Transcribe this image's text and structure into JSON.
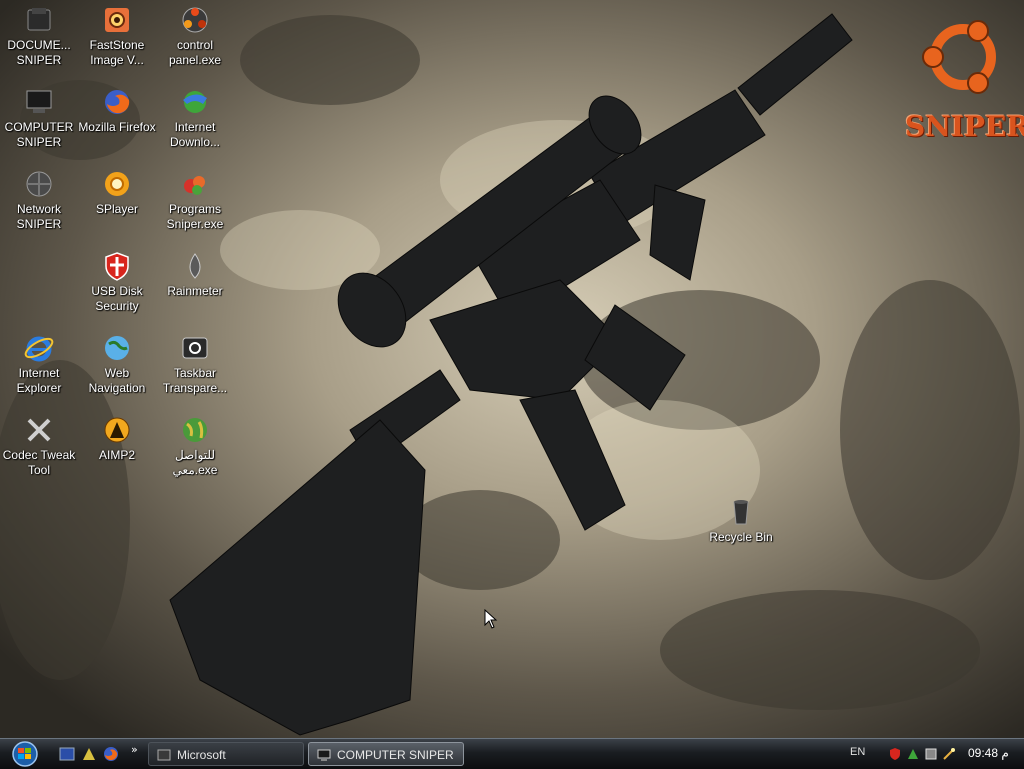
{
  "desktop": {
    "icons": [
      {
        "name": "documents-sniper",
        "label": "DOCUME... SNIPER",
        "icon": "folder-icon"
      },
      {
        "name": "faststone",
        "label": "FastStone Image V...",
        "icon": "faststone-icon"
      },
      {
        "name": "control-panel",
        "label": "control panel.exe",
        "icon": "control-panel-icon"
      },
      {
        "name": "computer-sniper",
        "label": "COMPUTER SNIPER",
        "icon": "computer-icon"
      },
      {
        "name": "firefox",
        "label": "Mozilla Firefox",
        "icon": "firefox-icon"
      },
      {
        "name": "idm",
        "label": "Internet Downlo...",
        "icon": "download-manager-icon"
      },
      {
        "name": "network-sniper",
        "label": "Network SNIPER",
        "icon": "network-icon"
      },
      {
        "name": "splayer",
        "label": "SPlayer",
        "icon": "splayer-icon"
      },
      {
        "name": "programs-sniper",
        "label": "Programs Sniper.exe",
        "icon": "programs-icon"
      },
      {
        "name": "usb-disk-security",
        "label": "USB Disk Security",
        "icon": "shield-icon"
      },
      {
        "name": "rainmeter",
        "label": "Rainmeter",
        "icon": "rainmeter-icon"
      },
      {
        "name": "internet-explorer",
        "label": "Internet Explorer",
        "icon": "ie-icon"
      },
      {
        "name": "web-navigation",
        "label": "Web Navigation",
        "icon": "globe-icon"
      },
      {
        "name": "taskbar-transparency",
        "label": "Taskbar Transpare...",
        "icon": "taskbar-icon"
      },
      {
        "name": "codec-tweak-tool",
        "label": "Codec Tweak Tool",
        "icon": "tools-icon"
      },
      {
        "name": "aimp2",
        "label": "AIMP2",
        "icon": "aimp-icon"
      },
      {
        "name": "tawasol",
        "label": "للتواصل معي.exe",
        "icon": "earth-icon"
      },
      {
        "name": "recycle-bin",
        "label": "Recycle Bin",
        "icon": "recycle-bin-icon"
      }
    ],
    "logo_text": "SNIPER"
  },
  "taskbar": {
    "quick_launch_chevron": "»",
    "tasks": [
      {
        "label": "Microsoft"
      },
      {
        "label": "COMPUTER SNIPER"
      }
    ],
    "language": "EN",
    "clock": "09:48 م"
  },
  "colors": {
    "logo_orange": "#d9541e",
    "taskbar_dark": "#1a1d21"
  }
}
